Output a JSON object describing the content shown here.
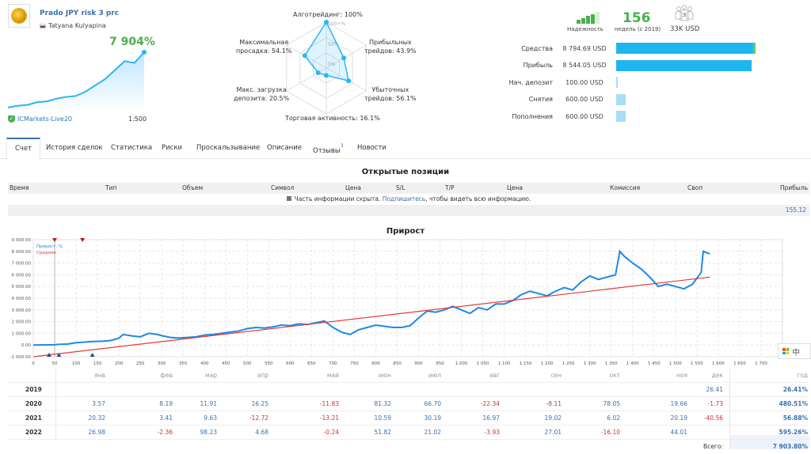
{
  "signal": {
    "title": "Prado JPY risk 3 prc",
    "author": "Tatyana Kulyapina",
    "growth": "7 904%",
    "broker": "ICMarkets-Live20",
    "leverage": "1:500",
    "mini_chart": [
      0,
      2,
      3,
      6,
      7,
      10,
      12,
      13,
      18,
      25,
      32,
      42,
      52,
      50,
      62
    ],
    "accent": "#29b6f6"
  },
  "radar": {
    "labels": [
      {
        "text": "Алготрейдинг: 100%",
        "value": 100
      },
      {
        "text": "Прибыльных\nтрейдов: 43.9%",
        "value": 43.9
      },
      {
        "text": "Убыточных\nтрейдов: 56.1%",
        "value": 56.1
      },
      {
        "text": "Торговая активность: 16.1%",
        "value": 16.1
      },
      {
        "text": "Макс. загрузка\nдепозита: 20.5%",
        "value": 20.5
      },
      {
        "text": "Максимальная\nпросадка: 54.1%",
        "value": 54.1
      }
    ],
    "scale": [
      "100+%",
      "50%",
      "0%"
    ]
  },
  "stats": {
    "reliability_label": "Надежность",
    "reliability_level": 4,
    "reliability_max": 5,
    "weeks": "156",
    "weeks_label": "недель (с 2019)",
    "subscribers": "3",
    "subs_funds": "33K USD",
    "rows": [
      {
        "label": "Средства",
        "value": "8 794.69 USD",
        "fraction": 1.0,
        "color": "#1fb6ef",
        "tip": "#5cd15c"
      },
      {
        "label": "Прибыль",
        "value": "8 544.05 USD",
        "fraction": 0.97,
        "color": "#1fb6ef"
      },
      {
        "label": "Нач. депозит",
        "value": "100.00 USD",
        "fraction": 0.011,
        "color": "#a8dff6"
      },
      {
        "label": "Снятия",
        "value": "600.00 USD",
        "fraction": 0.068,
        "color": "#a8dff6"
      },
      {
        "label": "Пополнения",
        "value": "600.00 USD",
        "fraction": 0.068,
        "color": "#a8dff6"
      }
    ]
  },
  "tabs": [
    {
      "label": "Счет",
      "active": true
    },
    {
      "label": "История сделок"
    },
    {
      "label": "Статистика"
    },
    {
      "label": "Риски"
    },
    {
      "label": "Проскальзывание"
    },
    {
      "label": "Описание"
    },
    {
      "label": "Отзывы",
      "badge": "3"
    },
    {
      "label": "Новости"
    }
  ],
  "open_positions": {
    "title": "Открытые позиции",
    "columns": [
      "Время",
      "Тип",
      "Объем",
      "Символ",
      "Цена",
      "S/L",
      "T/P",
      "Цена",
      "Комиссия",
      "Своп",
      "Прибыль"
    ],
    "info_prefix": "Часть информации скрыта. ",
    "info_link": "Подпишитесь",
    "info_suffix": ", чтобы видеть всю информацию.",
    "total": "155.12"
  },
  "chart_data": {
    "type": "line",
    "title": "Прирост",
    "legend": [
      "Прирост, %",
      "Среднее"
    ],
    "legend_position": "top-left",
    "ylim": [
      -1000,
      9000
    ],
    "yticks": [
      "9 000.00",
      "8 000.00",
      "7 000.00",
      "6 000.00",
      "5 000.00",
      "4 000.00",
      "3 000.00",
      "2 000.00",
      "1 000.00",
      "0.00",
      "-1 000.00"
    ],
    "xlim": [
      0,
      1750
    ],
    "xticks": [
      "0",
      "50",
      "100",
      "150",
      "200",
      "250",
      "300",
      "350",
      "400",
      "450",
      "500",
      "550",
      "600",
      "650",
      "700",
      "750",
      "800",
      "850",
      "900",
      "950",
      "1 000",
      "1 050",
      "1 100",
      "1 150",
      "1 200",
      "1 250",
      "1 300",
      "1 350",
      "1 400",
      "1 450",
      "1 500",
      "1 550",
      "1 600",
      "1 650",
      "1 700"
    ],
    "grid": true,
    "series": [
      {
        "name": "Прирост, %",
        "color": "#1e88e5",
        "x": [
          0,
          50,
          60,
          80,
          100,
          120,
          140,
          160,
          180,
          200,
          210,
          230,
          250,
          270,
          290,
          300,
          320,
          340,
          360,
          380,
          400,
          420,
          440,
          460,
          480,
          500,
          520,
          540,
          560,
          580,
          600,
          620,
          640,
          660,
          680,
          700,
          720,
          740,
          760,
          780,
          800,
          820,
          840,
          860,
          880,
          900,
          920,
          940,
          960,
          980,
          1000,
          1020,
          1040,
          1060,
          1080,
          1100,
          1120,
          1140,
          1160,
          1180,
          1200,
          1220,
          1240,
          1260,
          1280,
          1300,
          1320,
          1340,
          1360,
          1370,
          1380,
          1400,
          1420,
          1440,
          1460,
          1480,
          1500,
          1520,
          1540,
          1560,
          1565,
          1580
        ],
        "y": [
          0,
          20,
          60,
          80,
          200,
          250,
          300,
          320,
          380,
          580,
          900,
          780,
          700,
          1000,
          900,
          800,
          650,
          600,
          650,
          700,
          850,
          900,
          1000,
          1100,
          1200,
          1400,
          1500,
          1450,
          1550,
          1700,
          1650,
          1800,
          1750,
          1900,
          2050,
          1500,
          1100,
          900,
          1300,
          1500,
          1700,
          1600,
          1500,
          1500,
          1650,
          2300,
          2900,
          2800,
          3000,
          3300,
          3000,
          2700,
          3200,
          3000,
          3500,
          3500,
          3800,
          4300,
          4600,
          4400,
          4200,
          4600,
          4900,
          4700,
          5400,
          5900,
          5600,
          5800,
          6000,
          8000,
          7600,
          7000,
          6500,
          5800,
          5000,
          5200,
          5000,
          4800,
          5200,
          6200,
          8000,
          7800
        ],
        "note": "approximate"
      },
      {
        "name": "Среднее",
        "color": "#e53935",
        "x": [
          0,
          1580
        ],
        "y": [
          -1000,
          5800
        ]
      }
    ]
  },
  "monthly": {
    "headers": [
      "янв",
      "фев",
      "мар",
      "апр",
      "май",
      "июн",
      "июл",
      "авг",
      "сен",
      "окт",
      "ноя",
      "дек"
    ],
    "year_header": "год",
    "rows": [
      {
        "year": "2019",
        "months": [
          "",
          "",
          "",
          "",
          "",
          "",
          "",
          "",
          "",
          "",
          "",
          "26.41"
        ],
        "total": "26.41%"
      },
      {
        "year": "2020",
        "months": [
          "3.57",
          "8.19",
          "11.91",
          "16.25",
          "-11.83",
          "81.32",
          "66.70",
          "-22.34",
          "-8.11",
          "78.05",
          "19.66",
          "-1.73"
        ],
        "total": "480.51%"
      },
      {
        "year": "2021",
        "months": [
          "20.32",
          "3.41",
          "9.63",
          "-12.72",
          "-13.21",
          "10.59",
          "30.19",
          "16.97",
          "19.02",
          "6.02",
          "20.19",
          "-40.56"
        ],
        "total": "56.88%"
      },
      {
        "year": "2022",
        "months": [
          "26.98",
          "-2.36",
          "98.23",
          "4.68",
          "-0.24",
          "51.82",
          "21.02",
          "-3.93",
          "27.01",
          "-16.10",
          "44.01",
          ""
        ],
        "total": "595.26%"
      }
    ],
    "total_label": "Всего:",
    "grand_total": "7 903.80%"
  },
  "ime": {
    "label": "中"
  }
}
